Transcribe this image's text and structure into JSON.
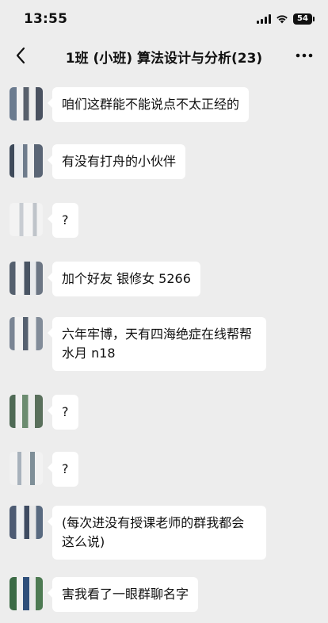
{
  "status_bar": {
    "time": "13:55",
    "battery": "54"
  },
  "nav": {
    "title": "1班 (小班) 算法设计与分析(23)"
  },
  "messages": [
    {
      "text": "咱们这群能不能说点不太正经的"
    },
    {
      "text": "有没有打舟的小伙伴"
    },
    {
      "text": "?"
    },
    {
      "text": "加个好友 银修女 5266"
    },
    {
      "text": "六年牢博，天有四海绝症在线帮帮水月 n18"
    },
    {
      "text": "?"
    },
    {
      "text": "?"
    },
    {
      "text": "(每次进没有授课老师的群我都会这么说)"
    },
    {
      "text": "害我看了一眼群聊名字"
    }
  ],
  "colors": {
    "background": "#ededed",
    "bubble": "#ffffff"
  }
}
